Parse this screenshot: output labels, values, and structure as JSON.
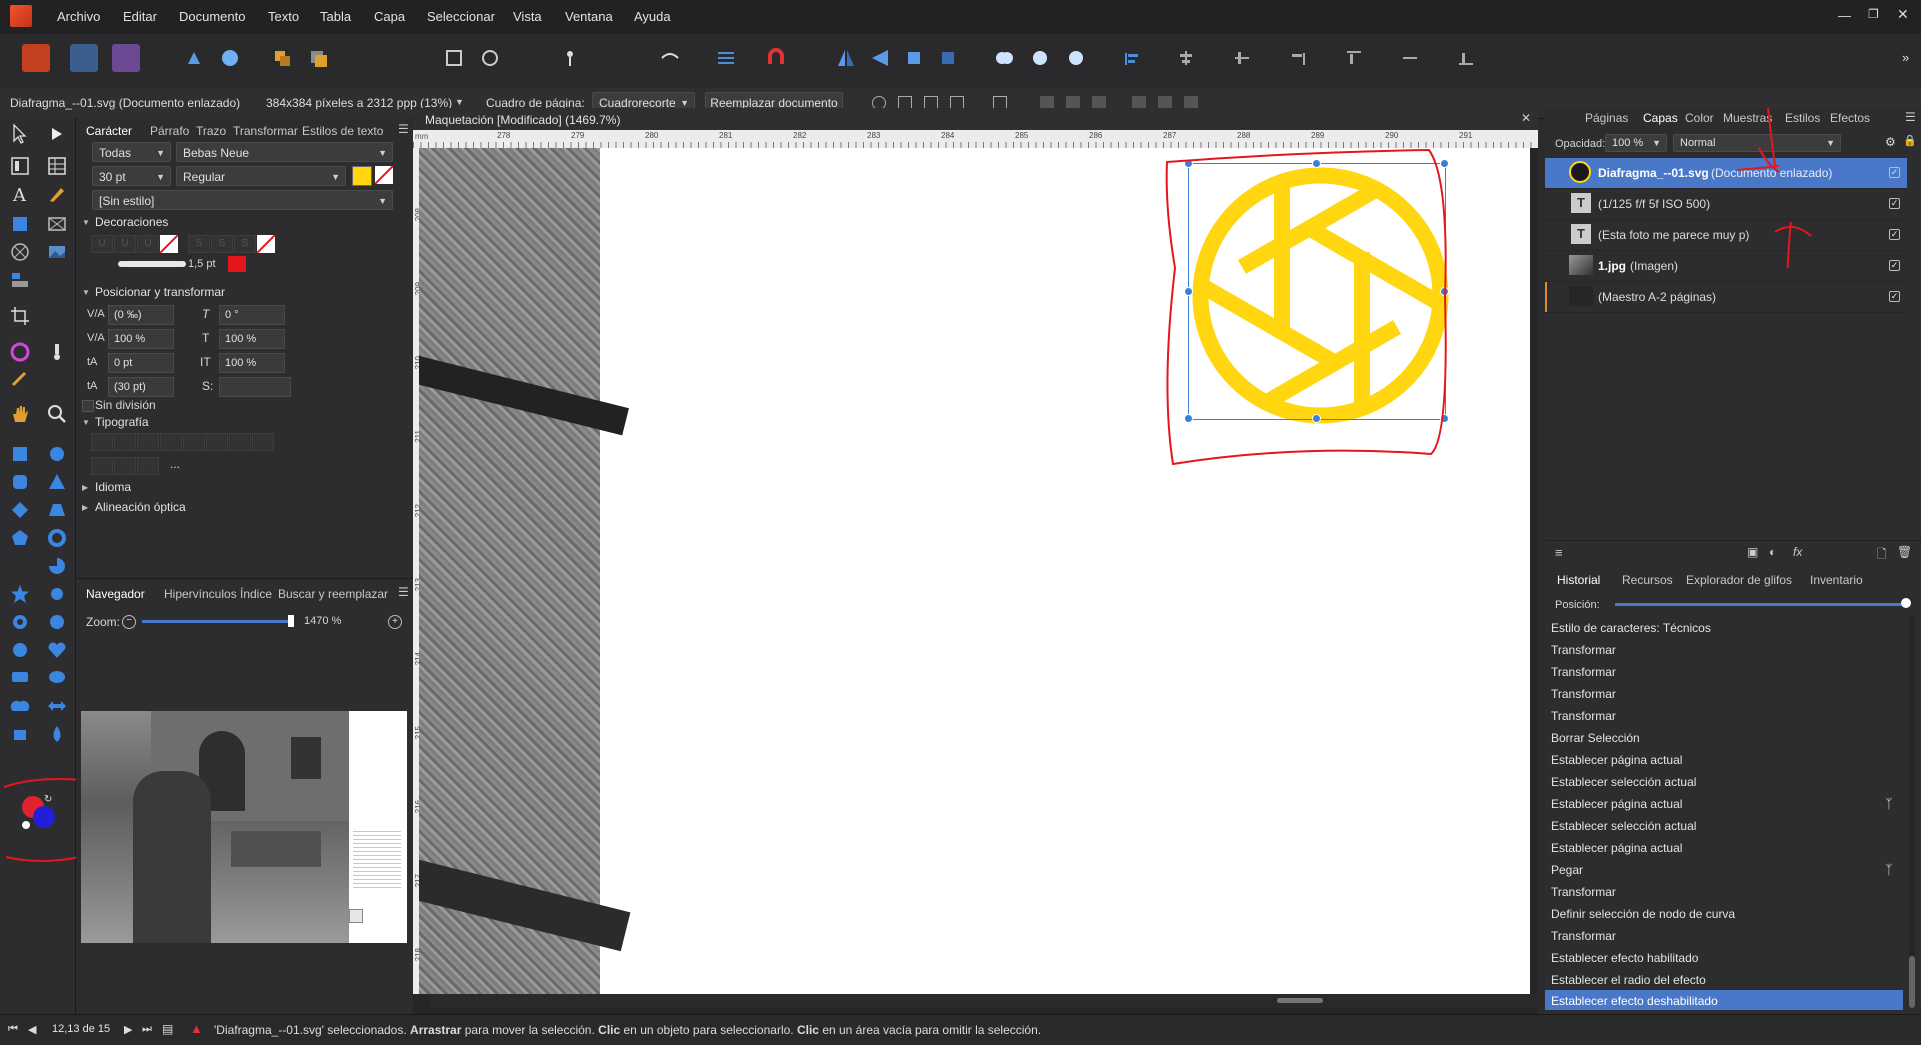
{
  "menu": [
    "Archivo",
    "Editar",
    "Documento",
    "Texto",
    "Tabla",
    "Capa",
    "Seleccionar",
    "Vista",
    "Ventana",
    "Ayuda"
  ],
  "context_bar": {
    "doc_name": "Diafragma_--01.svg (Documento enlazado)",
    "resolution": "384x384 píxeles a 2312 ppp (13%)",
    "page_box_label": "Cuadro de página:",
    "page_box_value": "Cuadrorecorte",
    "replace_button": "Reemplazar documento"
  },
  "character_panel": {
    "tabs": [
      "Carácter",
      "Párrafo",
      "Trazo",
      "Transformar",
      "Estilos de texto"
    ],
    "font_collection": "Todas",
    "font_name": "Bebas Neue",
    "font_size": "30 pt",
    "font_weight": "Regular",
    "style": "[Sin estilo]",
    "decorations_title": "Decoraciones",
    "stroke_width": "1,5 pt",
    "position_title": "Posicionar y transformar",
    "tracking": "(0 ‰)",
    "shear": "0 °",
    "scale_x": "100 %",
    "vscale": "100 %",
    "baseline": "0 pt",
    "hscale": "100 %",
    "leading": "(30 pt)",
    "no_break": "Sin división",
    "typography_title": "Tipografía",
    "language": "Idioma",
    "optical": "Alineación óptica",
    "ellipsis": "..."
  },
  "navigator": {
    "tabs": [
      "Navegador",
      "Hipervínculos",
      "Índice",
      "Buscar y reemplazar"
    ],
    "zoom_label": "Zoom:",
    "zoom_value": "1470 %"
  },
  "document": {
    "title": "Maquetación [Modificado] (1469.7%)",
    "ruler_top": [
      "278",
      "279",
      "280",
      "281",
      "282",
      "283",
      "284",
      "285",
      "286",
      "287",
      "288",
      "289",
      "290",
      "291"
    ],
    "ruler_left": [
      "208",
      "209",
      "210",
      "211",
      "212",
      "213",
      "214",
      "215",
      "216",
      "217",
      "218"
    ],
    "ruler_unit": "mm"
  },
  "layers_panel": {
    "tabs": [
      "Páginas",
      "Capas",
      "Color",
      "Muestras",
      "Estilos",
      "Efectos"
    ],
    "opacity_label": "Opacidad:",
    "opacity_value": "100 %",
    "blend_mode": "Normal",
    "layers": [
      {
        "name": "Diafragma_--01.svg",
        "suffix": " (Documento enlazado)",
        "selected": true
      },
      {
        "name": "(1/125 f/f 5f ISO 500)",
        "suffix": "",
        "selected": false
      },
      {
        "name": "(Esta foto me parece muy p)",
        "suffix": "",
        "selected": false
      },
      {
        "name": "1.jpg",
        "suffix": " (Imagen)",
        "selected": false
      },
      {
        "name": "(Maestro A-2 páginas)",
        "suffix": "",
        "selected": false
      }
    ]
  },
  "history_panel": {
    "tabs": [
      "Historial",
      "Recursos",
      "Explorador de glifos",
      "Inventario"
    ],
    "position_label": "Posición:",
    "items": [
      "Estilo de caracteres: Técnicos",
      "Transformar",
      "Transformar",
      "Transformar",
      "Transformar",
      "Borrar Selección",
      "Establecer página actual",
      "Establecer selección actual",
      "Establecer página actual",
      "Establecer selección actual",
      "Establecer página actual",
      "Pegar",
      "Transformar",
      "Definir selección de nodo de curva",
      "Transformar",
      "Establecer efecto habilitado",
      "Establecer el radio del efecto",
      "Establecer efecto deshabilitado"
    ]
  },
  "status": {
    "page": "12,13 de 15",
    "msg_a": "'Diafragma_--01.svg' seleccionados.",
    "msg_b": "Arrastrar",
    "msg_c": " para mover la selección.",
    "msg_d": "Clic",
    "msg_e": " en un objeto para seleccionarlo.",
    "msg_f": "Clic",
    "msg_g": " en un área vacía para omitir la selección."
  },
  "colors": {
    "accent": "#4a78c8",
    "aperture_yellow": "#ffd60f",
    "annotation_red": "#e3171c",
    "selection_blue": "#3c7fd6"
  }
}
